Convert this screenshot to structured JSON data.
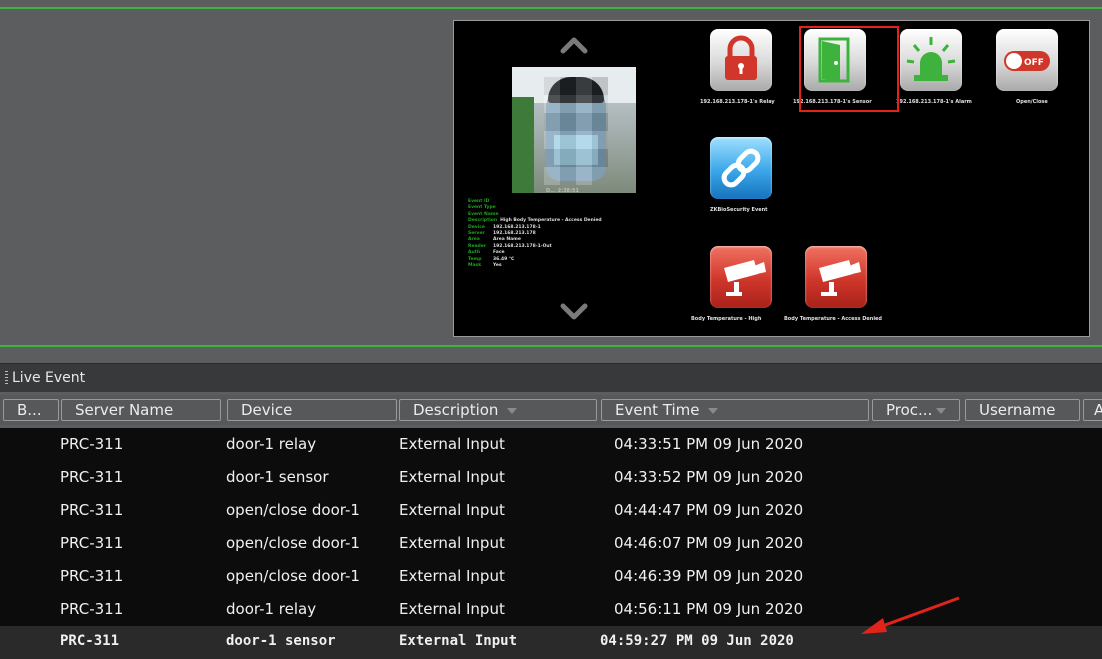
{
  "event_panel": {
    "face_caption": "D... 2:38:51",
    "info_rows": [
      {
        "key": "Event ID",
        "value": ""
      },
      {
        "key": "Event Type",
        "value": ""
      },
      {
        "key": "Event Name",
        "value": ""
      },
      {
        "key": "Description",
        "value": "High Body Temperature - Access Denied"
      },
      {
        "key": "Device",
        "value": "192.168.213.178-1"
      },
      {
        "key": "Server",
        "value": "192.168.213.178"
      },
      {
        "key": "Area",
        "value": "Area Name"
      },
      {
        "key": "Reader",
        "value": "192.168.213.178-1-Out"
      },
      {
        "key": "Auth",
        "value": "Face"
      },
      {
        "key": "Temp",
        "value": "36.49 ℃"
      },
      {
        "key": "Mask",
        "value": "Yes"
      }
    ],
    "tiles": [
      {
        "label": "192.168.213.178-1's Relay",
        "icon": "lock-icon",
        "color": "#d0362a"
      },
      {
        "label": "192.168.213.178-1's Sensor",
        "icon": "door-icon",
        "color": "#3db33d"
      },
      {
        "label": "192.168.213.178-1's Alarm",
        "icon": "alarm-light-icon",
        "color": "#3db33d"
      },
      {
        "label": "Open/Close",
        "icon": "toggle-off-icon",
        "color": "#d0362a"
      },
      {
        "label": "ZKBioSecurity Event",
        "icon": "link-icon",
        "color": "#1772bd"
      },
      {
        "label": "Body Temperature - High",
        "icon": "camera-icon",
        "color": "#d0362a"
      },
      {
        "label": "Body Temperature - Access Denied",
        "icon": "camera-icon",
        "color": "#d0362a"
      }
    ]
  },
  "live_event": {
    "title": "Live Event",
    "columns": [
      "B...",
      "Server Name",
      "Device",
      "Description",
      "Event Time",
      "Proc...",
      "Username",
      "A"
    ],
    "rows": [
      {
        "server": "PRC-311",
        "device": "door-1 relay",
        "description": "External Input",
        "time": "04:33:51 PM 09 Jun 2020"
      },
      {
        "server": "PRC-311",
        "device": "door-1 sensor",
        "description": "External Input",
        "time": "04:33:52 PM 09 Jun 2020"
      },
      {
        "server": "PRC-311",
        "device": "open/close door-1",
        "description": "External Input",
        "time": "04:44:47 PM 09 Jun 2020"
      },
      {
        "server": "PRC-311",
        "device": "open/close door-1",
        "description": "External Input",
        "time": "04:46:07 PM 09 Jun 2020"
      },
      {
        "server": "PRC-311",
        "device": "open/close door-1",
        "description": "External Input",
        "time": "04:46:39 PM 09 Jun 2020"
      },
      {
        "server": "PRC-311",
        "device": "door-1 relay",
        "description": "External Input",
        "time": "04:56:11 PM 09 Jun 2020"
      },
      {
        "server": "PRC-311",
        "device": "door-1 sensor",
        "description": "External Input",
        "time": "04:59:27 PM 09 Jun 2020"
      }
    ]
  },
  "colors": {
    "accent_green": "#3db33d",
    "annotation_red": "#e2231a"
  }
}
